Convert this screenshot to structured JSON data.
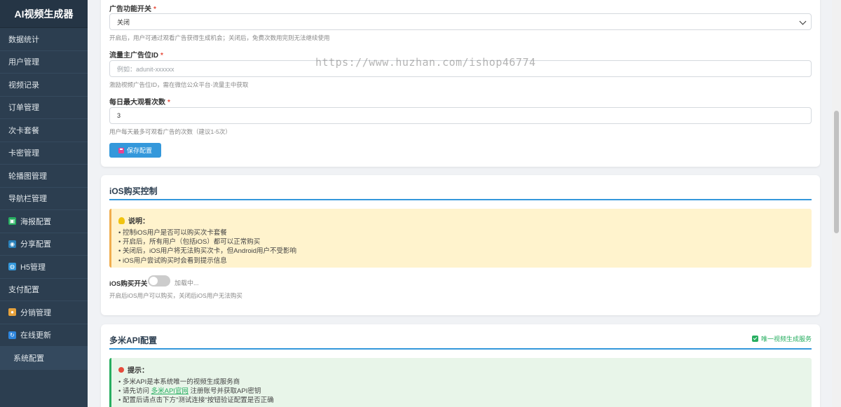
{
  "sidebar": {
    "brand": "AI视频生成器",
    "items": [
      {
        "label": "数据统计",
        "icon": ""
      },
      {
        "label": "用户管理",
        "icon": ""
      },
      {
        "label": "视频记录",
        "icon": ""
      },
      {
        "label": "订单管理",
        "icon": ""
      },
      {
        "label": "次卡套餐",
        "icon": ""
      },
      {
        "label": "卡密管理",
        "icon": ""
      },
      {
        "label": "轮播图管理",
        "icon": ""
      },
      {
        "label": "导航栏管理",
        "icon": ""
      },
      {
        "label": "海报配置",
        "icon": "image-icon",
        "icon_color": "#27ae60"
      },
      {
        "label": "分享配置",
        "icon": "share-icon",
        "icon_color": "#2980b9"
      },
      {
        "label": "H5管理",
        "icon": "globe-icon",
        "icon_color": "#3498db"
      },
      {
        "label": "支付配置",
        "icon": ""
      },
      {
        "label": "分销管理",
        "icon": "money-bag-icon",
        "icon_color": "#e6a23c"
      },
      {
        "label": "在线更新",
        "icon": "refresh-icon",
        "icon_color": "#2e86de"
      },
      {
        "label": "系统配置",
        "icon": "",
        "active": true
      }
    ]
  },
  "ad_config": {
    "switch_label": "广告功能开关",
    "switch_value": "关闭",
    "switch_help": "开启后，用户可通过观看广告获得生成机会；关闭后，免费次数用完则无法继续使用",
    "adunit_label": "流量主广告位ID",
    "adunit_placeholder": "例如：adunit-xxxxxx",
    "adunit_help": "激励视频广告位ID，需在微信公众平台-流量主中获取",
    "max_label": "每日最大观看次数",
    "max_value": "3",
    "max_help": "用户每天最多可观看广告的次数（建议1-5次）",
    "save_label": "保存配置"
  },
  "ios": {
    "title": "iOS购买控制",
    "notice_title": "说明：",
    "notice_lines": [
      "• 控制iOS用户是否可以购买次卡套餐",
      "• 开启后，所有用户（包括iOS）都可以正常购买",
      "• 关闭后，iOS用户将无法购买次卡，但Android用户不受影响",
      "• iOS用户尝试购买时会看到提示信息"
    ],
    "toggle_label": "iOS购买开关",
    "toggle_status": "加载中...",
    "toggle_on": false,
    "toggle_help": "开启后iOS用户可以购买，关闭后iOS用户无法购买"
  },
  "duomi": {
    "title": "多米API配置",
    "badge": "唯一视频生成服务",
    "notice_title": "提示：",
    "line1": "• 多米API是本系统唯一的视频生成服务商",
    "line2_prefix": "• 请先访问 ",
    "line2_link": "多米API官网",
    "line2_suffix": " 注册账号并获取API密钥",
    "line3": "• 配置后请点击下方\"测试连接\"按钮验证配置是否正确"
  },
  "watermark": "https://www.huzhan.com/ishop46774"
}
